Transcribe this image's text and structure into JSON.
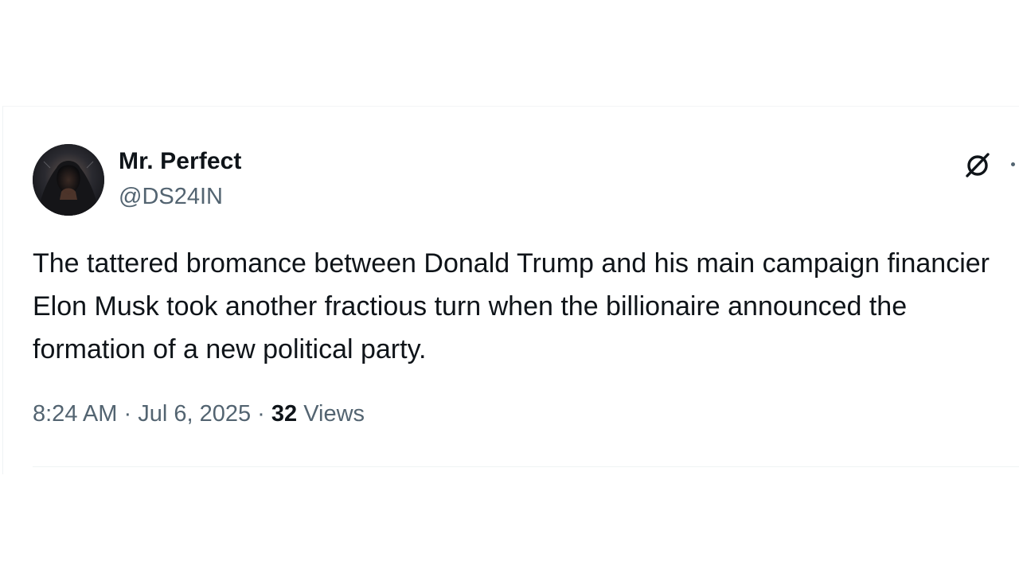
{
  "tweet": {
    "author": {
      "display_name": "Mr. Perfect",
      "handle": "@DS24IN",
      "avatar": "hooded-figure-avatar"
    },
    "text": "The tattered bromance between Donald Trump and his main campaign financier Elon Musk took another fractious turn when the billionaire announced the formation of a new political party.",
    "time": "8:24 AM",
    "separator": "·",
    "date": "Jul 6, 2025",
    "views_count": "32",
    "views_label": "Views"
  },
  "icons": {
    "grok": "grok-icon",
    "more": "more-options-icon"
  },
  "colors": {
    "text_primary": "#0f1419",
    "text_secondary": "#536471",
    "divider": "#eff3f4"
  }
}
